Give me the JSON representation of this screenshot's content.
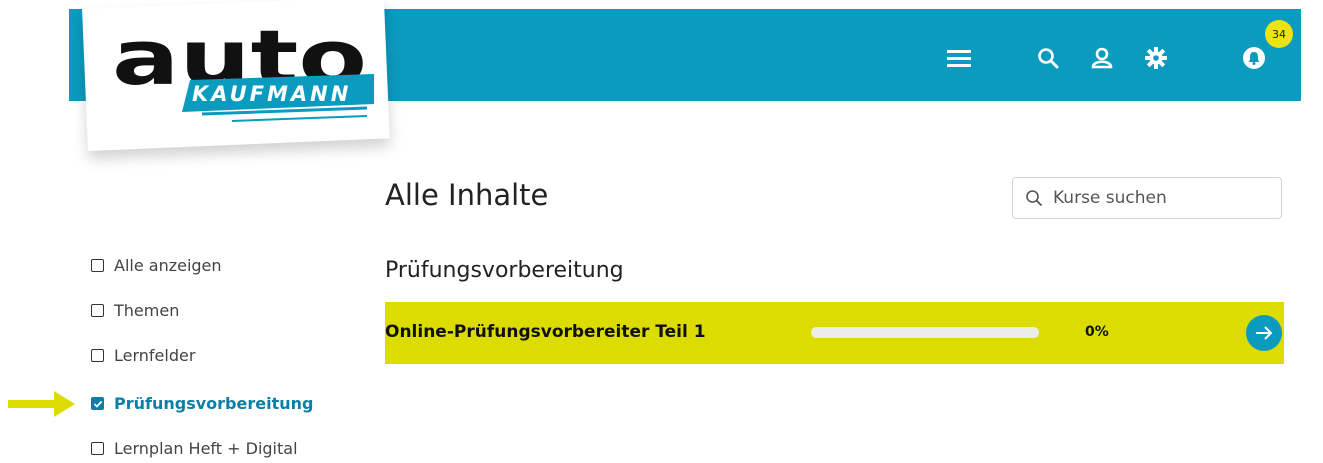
{
  "brand": {
    "logo_word": "auto",
    "logo_sub": "KAUFMANN"
  },
  "header": {
    "icons": [
      "menu-icon",
      "search-icon",
      "user-icon",
      "gear-icon",
      "bell-icon"
    ],
    "notification_count": "34"
  },
  "page": {
    "title": "Alle Inhalte"
  },
  "search": {
    "placeholder": "Kurse suchen"
  },
  "section": {
    "title": "Prüfungsvorbereitung"
  },
  "courses": [
    {
      "title": "Online-Prüfungsvorbereiter Teil 1",
      "progress": 0,
      "progress_label": "0%"
    }
  ],
  "filters": [
    {
      "label": "Alle anzeigen",
      "checked": false
    },
    {
      "label": "Themen",
      "checked": false
    },
    {
      "label": "Lernfelder",
      "checked": false
    },
    {
      "label": "Prüfungsvorbereitung",
      "checked": true
    },
    {
      "label": "Lernplan Heft + Digital",
      "checked": false
    }
  ],
  "colors": {
    "brand": "#0b9bbf",
    "accent": "#dcdc00",
    "badge": "#ece315",
    "active_filter": "#0b7fa6"
  }
}
